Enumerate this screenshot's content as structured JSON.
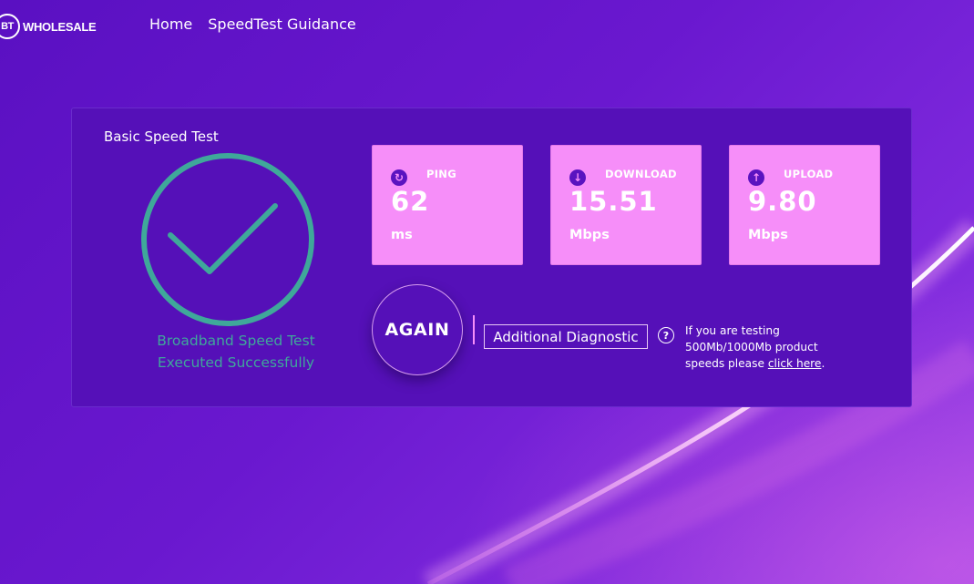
{
  "header": {
    "logo_mark": "BT",
    "logo_text": "WHOLESALE",
    "nav": [
      {
        "label": "Home"
      },
      {
        "label": "SpeedTest Guidance"
      }
    ]
  },
  "panel": {
    "title": "Basic Speed Test",
    "status_icon": "check-circle-icon",
    "status_line1": "Broadband Speed Test",
    "status_line2": "Executed Successfully",
    "stats": [
      {
        "label": "PING",
        "value": "62",
        "unit": "ms",
        "icon": "refresh-icon",
        "glyph": "↻"
      },
      {
        "label": "DOWNLOAD",
        "value": "15.51",
        "unit": "Mbps",
        "icon": "download-arrow-icon",
        "glyph": "↓"
      },
      {
        "label": "UPLOAD",
        "value": "9.80",
        "unit": "Mbps",
        "icon": "upload-arrow-icon",
        "glyph": "↑"
      }
    ],
    "again_label": "AGAIN",
    "diagnostic_label": "Additional Diagnostic",
    "help_icon_glyph": "?",
    "help_text_before": "If you are testing 500Mb/1000Mb product speeds please ",
    "help_link": "click here",
    "help_text_after": "."
  },
  "colors": {
    "panel_bg": "#5510b8",
    "card_bg": "#f68ef9",
    "success_green": "#3fa89a",
    "accent_pink": "#f68ef9"
  }
}
